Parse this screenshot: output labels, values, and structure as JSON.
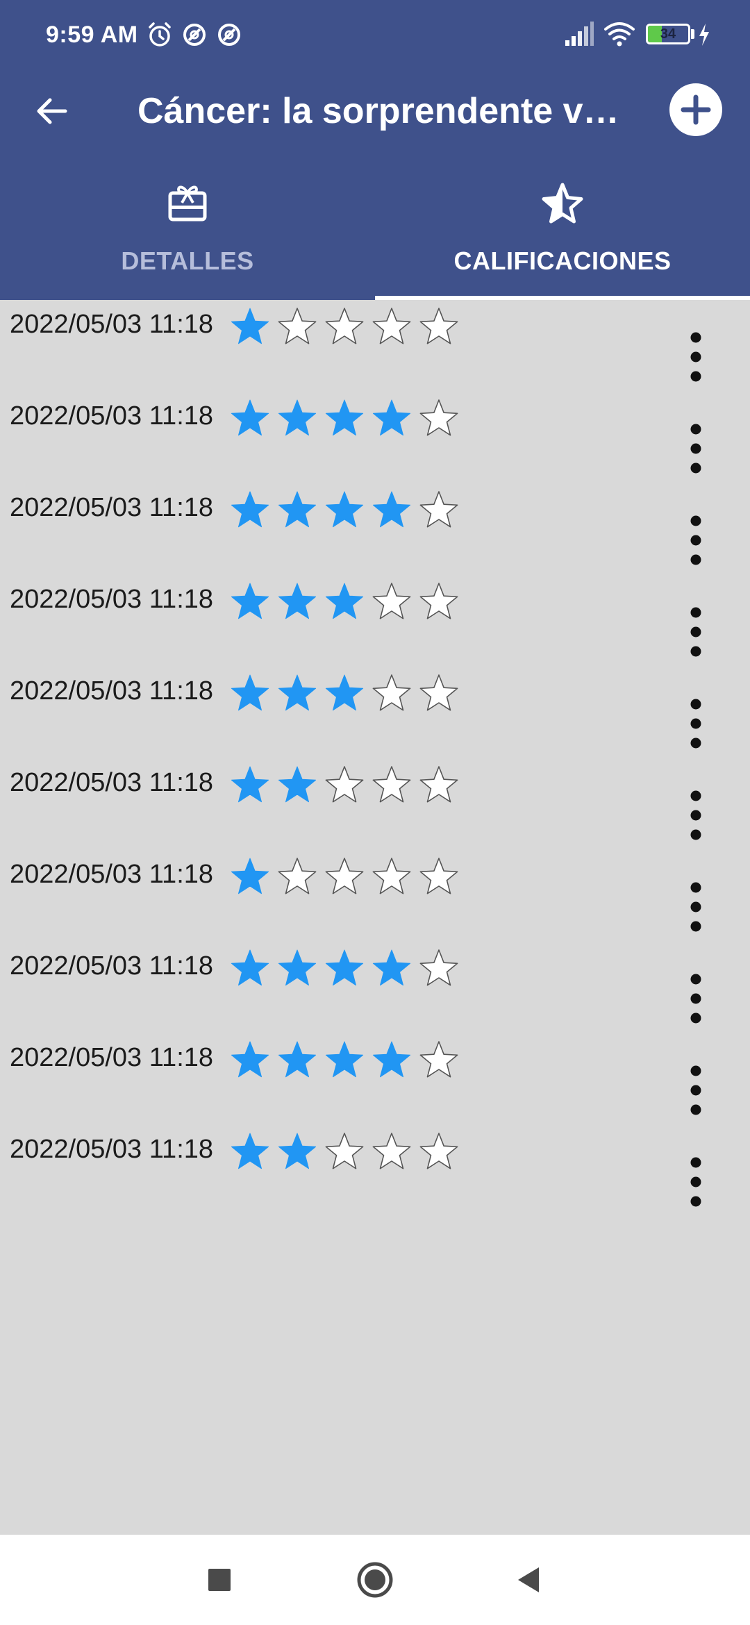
{
  "status_bar": {
    "time": "9:59 AM",
    "battery_level": "34",
    "battery_fraction": 0.34,
    "icons": [
      "alarm-icon",
      "sync-off-icon",
      "sync-off-icon",
      "signal-icon",
      "wifi-icon",
      "battery-icon",
      "charging-icon"
    ]
  },
  "header": {
    "title": "Cáncer: la sorprendente verdad sobre la enfermedad",
    "back_icon": "arrow-back-icon",
    "add_icon": "add-circle-icon",
    "background_color": "#3f518b"
  },
  "tabs": [
    {
      "label": "DETALLES",
      "icon": "card-giftcard-icon",
      "selected": false
    },
    {
      "label": "CALIFICACIONES",
      "icon": "star-half-icon",
      "selected": true
    }
  ],
  "ratings": {
    "max_stars": 5,
    "filled_color": "#2196f3",
    "empty_color": "#ffffff",
    "items": [
      {
        "date": "2022/05/03 11:18",
        "rating": 1
      },
      {
        "date": "2022/05/03 11:18",
        "rating": 4
      },
      {
        "date": "2022/05/03 11:18",
        "rating": 4
      },
      {
        "date": "2022/05/03 11:18",
        "rating": 3
      },
      {
        "date": "2022/05/03 11:18",
        "rating": 3
      },
      {
        "date": "2022/05/03 11:18",
        "rating": 2
      },
      {
        "date": "2022/05/03 11:18",
        "rating": 1
      },
      {
        "date": "2022/05/03 11:18",
        "rating": 4
      },
      {
        "date": "2022/05/03 11:18",
        "rating": 4
      },
      {
        "date": "2022/05/03 11:18",
        "rating": 2
      }
    ]
  },
  "nav_bar": {
    "buttons": [
      "recents-square-icon",
      "home-circle-icon",
      "back-triangle-icon"
    ]
  }
}
